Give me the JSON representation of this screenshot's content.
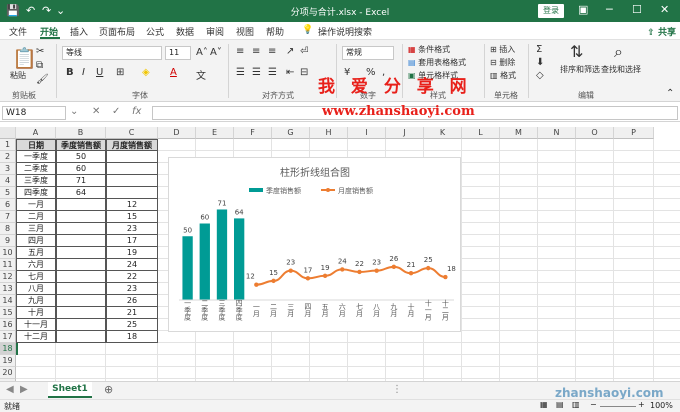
{
  "window": {
    "title": "分项与合计.xlsx  -  Excel",
    "login_label": "登录",
    "share_label": "共享"
  },
  "quick_access": {
    "save": "💾",
    "undo": "↶",
    "redo": "↷",
    "more": "⌄"
  },
  "menu": [
    "文件",
    "开始",
    "插入",
    "页面布局",
    "公式",
    "数据",
    "审阅",
    "视图",
    "帮助"
  ],
  "search_hint": "操作说明搜索",
  "ribbon": {
    "paste_label": "粘贴",
    "clipboard_label": "剪贴板",
    "font_name": "等线",
    "font_size": "11",
    "font_label": "字体",
    "align_label": "对齐方式",
    "number_format": "常规",
    "number_label": "数字",
    "cond_format": "条件格式",
    "table_format": "套用表格格式",
    "cell_style": "单元格样式",
    "style_label": "样式",
    "insert": "插入",
    "delete": "删除",
    "format": "格式",
    "cells_label": "单元格",
    "sort_filter": "排序和筛选",
    "find_select": "查找和选择",
    "edit_label": "编辑"
  },
  "watermark": {
    "text": "我 爱 分 享 网",
    "url": "www.zhanshaoyi.com",
    "url2": "zhanshaoyi.com"
  },
  "formula_bar": {
    "name_box": "W18",
    "fx": "fx",
    "content": ""
  },
  "columns": [
    "A",
    "B",
    "C",
    "D",
    "E",
    "F",
    "G",
    "H",
    "I",
    "J",
    "K",
    "L",
    "M",
    "N",
    "O",
    "P"
  ],
  "rows": [
    "1",
    "2",
    "3",
    "4",
    "5",
    "6",
    "7",
    "8",
    "9",
    "10",
    "11",
    "12",
    "13",
    "14",
    "15",
    "16",
    "17",
    "18",
    "19",
    "20",
    "21"
  ],
  "table": {
    "headers": [
      "日期",
      "季度销售额",
      "月度销售额"
    ],
    "rows": [
      [
        "一季度",
        "50",
        ""
      ],
      [
        "二季度",
        "60",
        ""
      ],
      [
        "三季度",
        "71",
        ""
      ],
      [
        "四季度",
        "64",
        ""
      ],
      [
        "一月",
        "",
        "12"
      ],
      [
        "二月",
        "",
        "15"
      ],
      [
        "三月",
        "",
        "23"
      ],
      [
        "四月",
        "",
        "17"
      ],
      [
        "五月",
        "",
        "19"
      ],
      [
        "六月",
        "",
        "24"
      ],
      [
        "七月",
        "",
        "22"
      ],
      [
        "八月",
        "",
        "23"
      ],
      [
        "九月",
        "",
        "26"
      ],
      [
        "十月",
        "",
        "21"
      ],
      [
        "十一月",
        "",
        "25"
      ],
      [
        "十二月",
        "",
        "18"
      ]
    ]
  },
  "chart_data": {
    "type": "bar",
    "title": "柱形折线组合图",
    "categories": [
      "一季度",
      "二季度",
      "三季度",
      "四季度",
      "一月",
      "二月",
      "三月",
      "四月",
      "五月",
      "六月",
      "七月",
      "八月",
      "九月",
      "十月",
      "十一月",
      "十二月"
    ],
    "series": [
      {
        "name": "季度销售额",
        "type": "bar",
        "color": "#009b95",
        "values": [
          50,
          60,
          71,
          64,
          null,
          null,
          null,
          null,
          null,
          null,
          null,
          null,
          null,
          null,
          null,
          null
        ]
      },
      {
        "name": "月度销售额",
        "type": "line",
        "color": "#ed7d31",
        "values": [
          null,
          null,
          null,
          null,
          12,
          15,
          23,
          17,
          19,
          24,
          22,
          23,
          26,
          21,
          25,
          18
        ]
      }
    ],
    "ylim": [
      0,
      80
    ],
    "legend": "top",
    "grid": false
  },
  "sheets": [
    "Sheet1"
  ],
  "status": {
    "ready": "就绪",
    "zoom": "100%"
  }
}
